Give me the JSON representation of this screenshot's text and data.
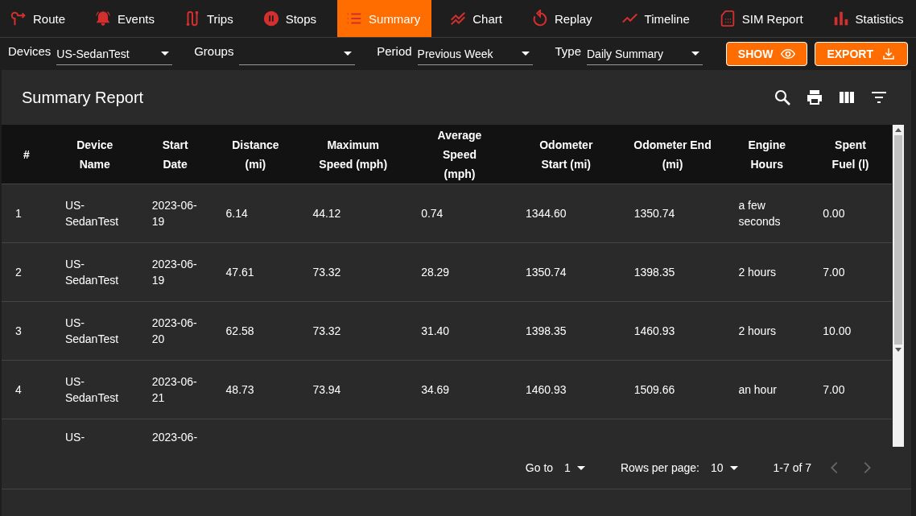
{
  "tabs": [
    {
      "label": "Route",
      "selected": false
    },
    {
      "label": "Events",
      "selected": false
    },
    {
      "label": "Trips",
      "selected": false
    },
    {
      "label": "Stops",
      "selected": false
    },
    {
      "label": "Summary",
      "selected": true
    },
    {
      "label": "Chart",
      "selected": false
    },
    {
      "label": "Replay",
      "selected": false
    },
    {
      "label": "Timeline",
      "selected": false
    },
    {
      "label": "SIM Report",
      "selected": false
    },
    {
      "label": "Statistics",
      "selected": false
    }
  ],
  "filters": [
    {
      "label": "Devices",
      "value": "US-SedanTest"
    },
    {
      "label": "Groups"
    },
    {
      "label": "Period",
      "value": "Previous Week"
    },
    {
      "label": "Type",
      "value": "Daily Summary"
    }
  ],
  "buttons": [
    {
      "label": "SHOW"
    },
    {
      "label": "EXPORT"
    }
  ],
  "report": {
    "title": "Summary Report",
    "columns": [
      "#",
      "Device Name",
      "Start Date",
      "Distance (mi)",
      "Maximum Speed (mph)",
      "Average Speed (mph)",
      "Odometer Start (mi)",
      "Odometer End (mi)",
      "Engine Hours",
      "Spent Fuel (l)"
    ],
    "rows": [
      [
        "1",
        "US-SedanTest",
        "2023-06-19",
        "6.14",
        "44.12",
        "0.74",
        "1344.60",
        "1350.74",
        "a few seconds",
        "0.00"
      ],
      [
        "2",
        "US-SedanTest",
        "2023-06-19",
        "47.61",
        "73.32",
        "28.29",
        "1350.74",
        "1398.35",
        "2 hours",
        "7.00"
      ],
      [
        "3",
        "US-SedanTest",
        "2023-06-20",
        "62.58",
        "73.32",
        "31.40",
        "1398.35",
        "1460.93",
        "2 hours",
        "10.00"
      ],
      [
        "4",
        "US-SedanTest",
        "2023-06-21",
        "48.73",
        "73.94",
        "34.69",
        "1460.93",
        "1509.66",
        "an hour",
        "7.00"
      ]
    ],
    "partial_row": [
      "US-",
      "2023-06-"
    ],
    "pagination": {
      "goto_label": "Go to",
      "page": "1",
      "rows_label": "Rows per page:",
      "rows_per_page": "10",
      "range": "1-7 of 7"
    }
  }
}
